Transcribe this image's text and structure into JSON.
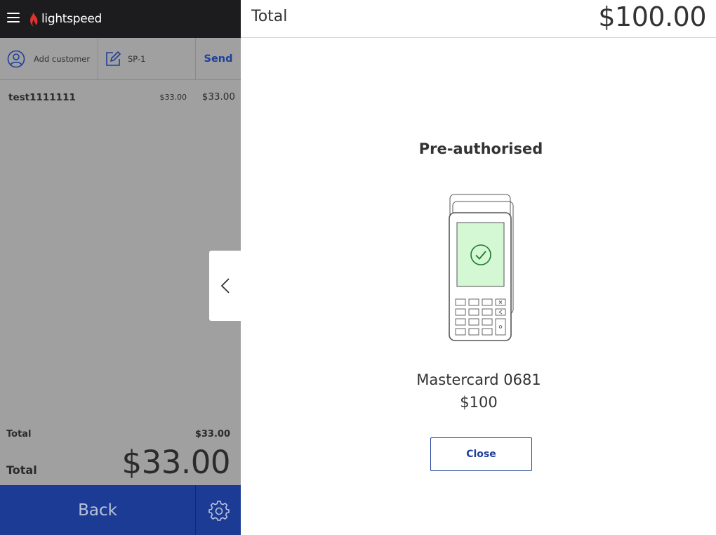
{
  "brand": {
    "name": "lightspeed",
    "accent": "#1c3b95",
    "flame_color": "#e0322d"
  },
  "customer_bar": {
    "add_customer_label": "Add customer",
    "sale_label": "SP-1",
    "send_label": "Send"
  },
  "items": [
    {
      "name": "test1111111",
      "unit_price": "$33.00",
      "line_total": "$33.00"
    }
  ],
  "totals": {
    "subtotal_label": "Total",
    "subtotal_value": "$33.00",
    "total_label": "Total",
    "total_value": "$33.00"
  },
  "bottom": {
    "back_label": "Back"
  },
  "payment": {
    "header_label": "Total",
    "header_value": "$100.00",
    "status": "Pre-authorised",
    "card": "Mastercard 0681",
    "amount": "$100",
    "close_label": "Close"
  },
  "icons": {
    "menu": "hamburger-icon",
    "customer": "user-circle-icon",
    "note": "edit-icon",
    "settings": "gear-icon",
    "collapse": "chevron-left-icon",
    "terminal": "card-terminal-icon",
    "success": "check-circle-icon"
  }
}
